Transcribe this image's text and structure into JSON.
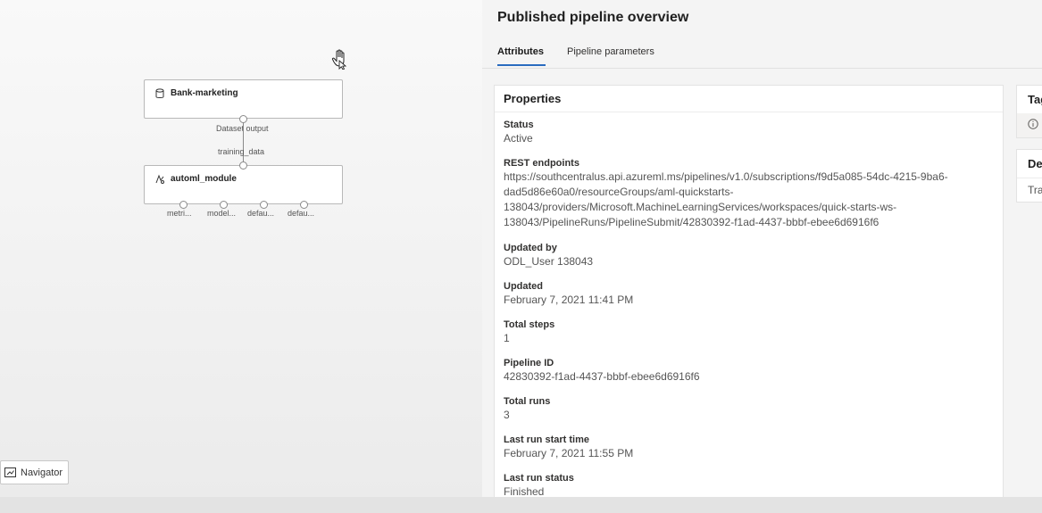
{
  "canvas": {
    "nodes": [
      {
        "label": "Bank-marketing",
        "icon": "database-icon"
      },
      {
        "label": "automl_module",
        "icon": "automl-icon"
      }
    ],
    "connector": {
      "output_label": "Dataset output",
      "input_label": "training_data"
    },
    "output_ports": [
      "metri...",
      "model...",
      "defau...",
      "defau..."
    ],
    "navigator_label": "Navigator"
  },
  "panel": {
    "title": "Published pipeline overview",
    "tabs": [
      {
        "label": "Attributes",
        "selected": true
      },
      {
        "label": "Pipeline parameters",
        "selected": false
      }
    ],
    "properties": {
      "header": "Properties",
      "status": {
        "label": "Status",
        "value": "Active"
      },
      "rest_endpoints": {
        "label": "REST endpoints",
        "lines": [
          "https://southcentralus.api.azureml.ms/pipelines/v1.0/subscriptions/f9d5a085-54dc-4215-9ba6-",
          "dad5d86e60a0/resourceGroups/aml-quickstarts-",
          "138043/providers/Microsoft.MachineLearningServices/workspaces/quick-starts-ws-",
          "138043/PipelineRuns/PipelineSubmit/42830392-f1ad-4437-bbbf-ebee6d6916f6"
        ]
      },
      "updated_by": {
        "label": "Updated by",
        "value": "ODL_User 138043"
      },
      "updated": {
        "label": "Updated",
        "value": "February 7, 2021 11:41 PM"
      },
      "total_steps": {
        "label": "Total steps",
        "value": "1"
      },
      "pipeline_id": {
        "label": "Pipeline ID",
        "value": "42830392-f1ad-4437-bbbf-ebee6d6916f6"
      },
      "total_runs": {
        "label": "Total runs",
        "value": "3"
      },
      "last_run_start": {
        "label": "Last run start time",
        "value": "February 7, 2021 11:55 PM"
      },
      "last_run_status": {
        "label": "Last run status",
        "value": "Finished"
      }
    },
    "tags_card": {
      "title": "Tag"
    },
    "description_card": {
      "title": "De",
      "text": "Tra"
    }
  },
  "colors": {
    "accent": "#2a6bbf",
    "canvas_bg": "#f5f5f5",
    "panel_bg": "#f4f4f4"
  }
}
